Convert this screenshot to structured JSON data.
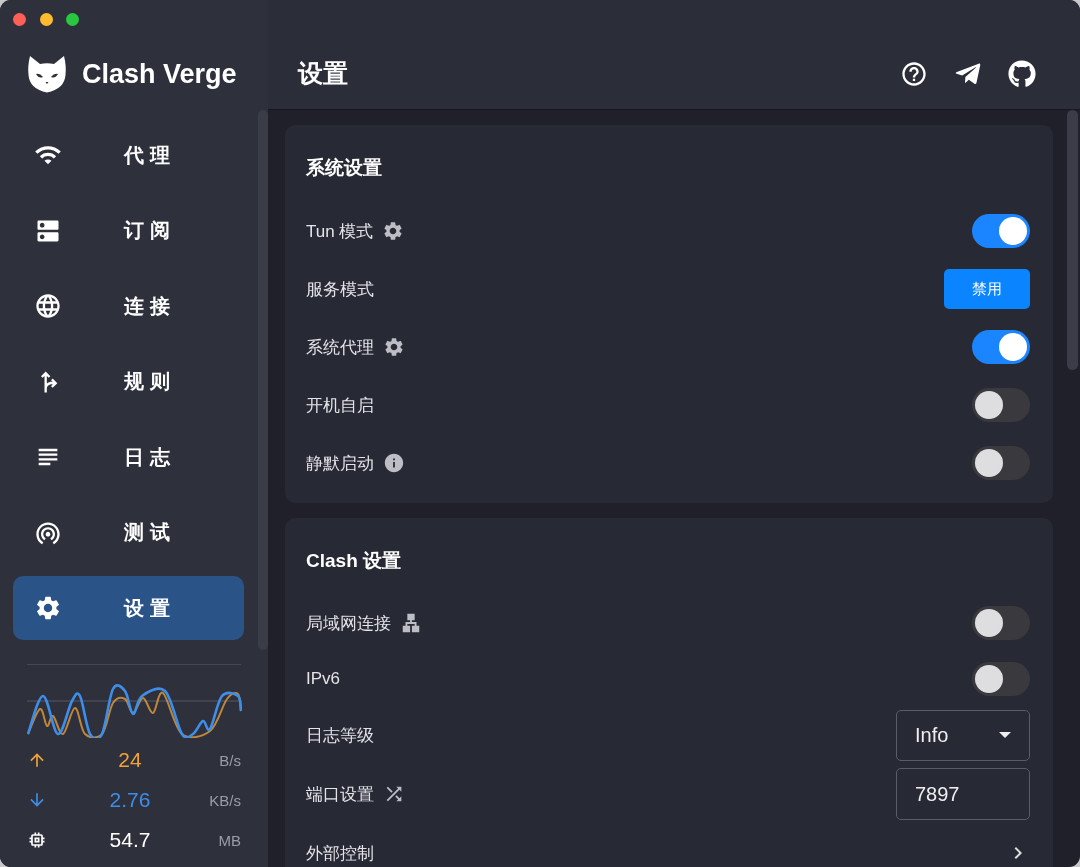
{
  "sidebar": {
    "logo_text": "Clash Verge",
    "nav_items": [
      {
        "label": "代理",
        "selected": false
      },
      {
        "label": "订阅",
        "selected": false
      },
      {
        "label": "连接",
        "selected": false
      },
      {
        "label": "规则",
        "selected": false
      },
      {
        "label": "日志",
        "selected": false
      },
      {
        "label": "测试",
        "selected": false
      },
      {
        "label": "设置",
        "selected": true
      }
    ],
    "stats": [
      {
        "kind": "upload",
        "value": "24",
        "unit": "B/s",
        "color": "#f0a33a"
      },
      {
        "kind": "download",
        "value": "2.76",
        "unit": "KB/s",
        "color": "#3e8ee8"
      },
      {
        "kind": "memory",
        "value": "54.7",
        "unit": "MB",
        "color": "#ffffff"
      }
    ]
  },
  "header": {
    "title": "设置"
  },
  "sections": [
    {
      "title": "系统设置",
      "rows": [
        {
          "label": "Tun 模式",
          "kind": "toggle",
          "on": true
        },
        {
          "label": "服务模式",
          "kind": "button",
          "button_label": "禁用"
        },
        {
          "label": "系统代理",
          "kind": "toggle",
          "on": true
        },
        {
          "label": "开机自启",
          "kind": "toggle",
          "on": false
        },
        {
          "label": "静默启动",
          "kind": "toggle",
          "on": false
        }
      ]
    },
    {
      "title": "Clash 设置",
      "rows": [
        {
          "label": "局域网连接",
          "kind": "toggle",
          "on": false
        },
        {
          "label": "IPv6",
          "kind": "toggle",
          "on": false
        },
        {
          "label": "日志等级",
          "kind": "select",
          "value": "Info"
        },
        {
          "label": "端口设置",
          "kind": "input",
          "value": "7897"
        },
        {
          "label": "外部控制",
          "kind": "link"
        }
      ]
    }
  ]
}
